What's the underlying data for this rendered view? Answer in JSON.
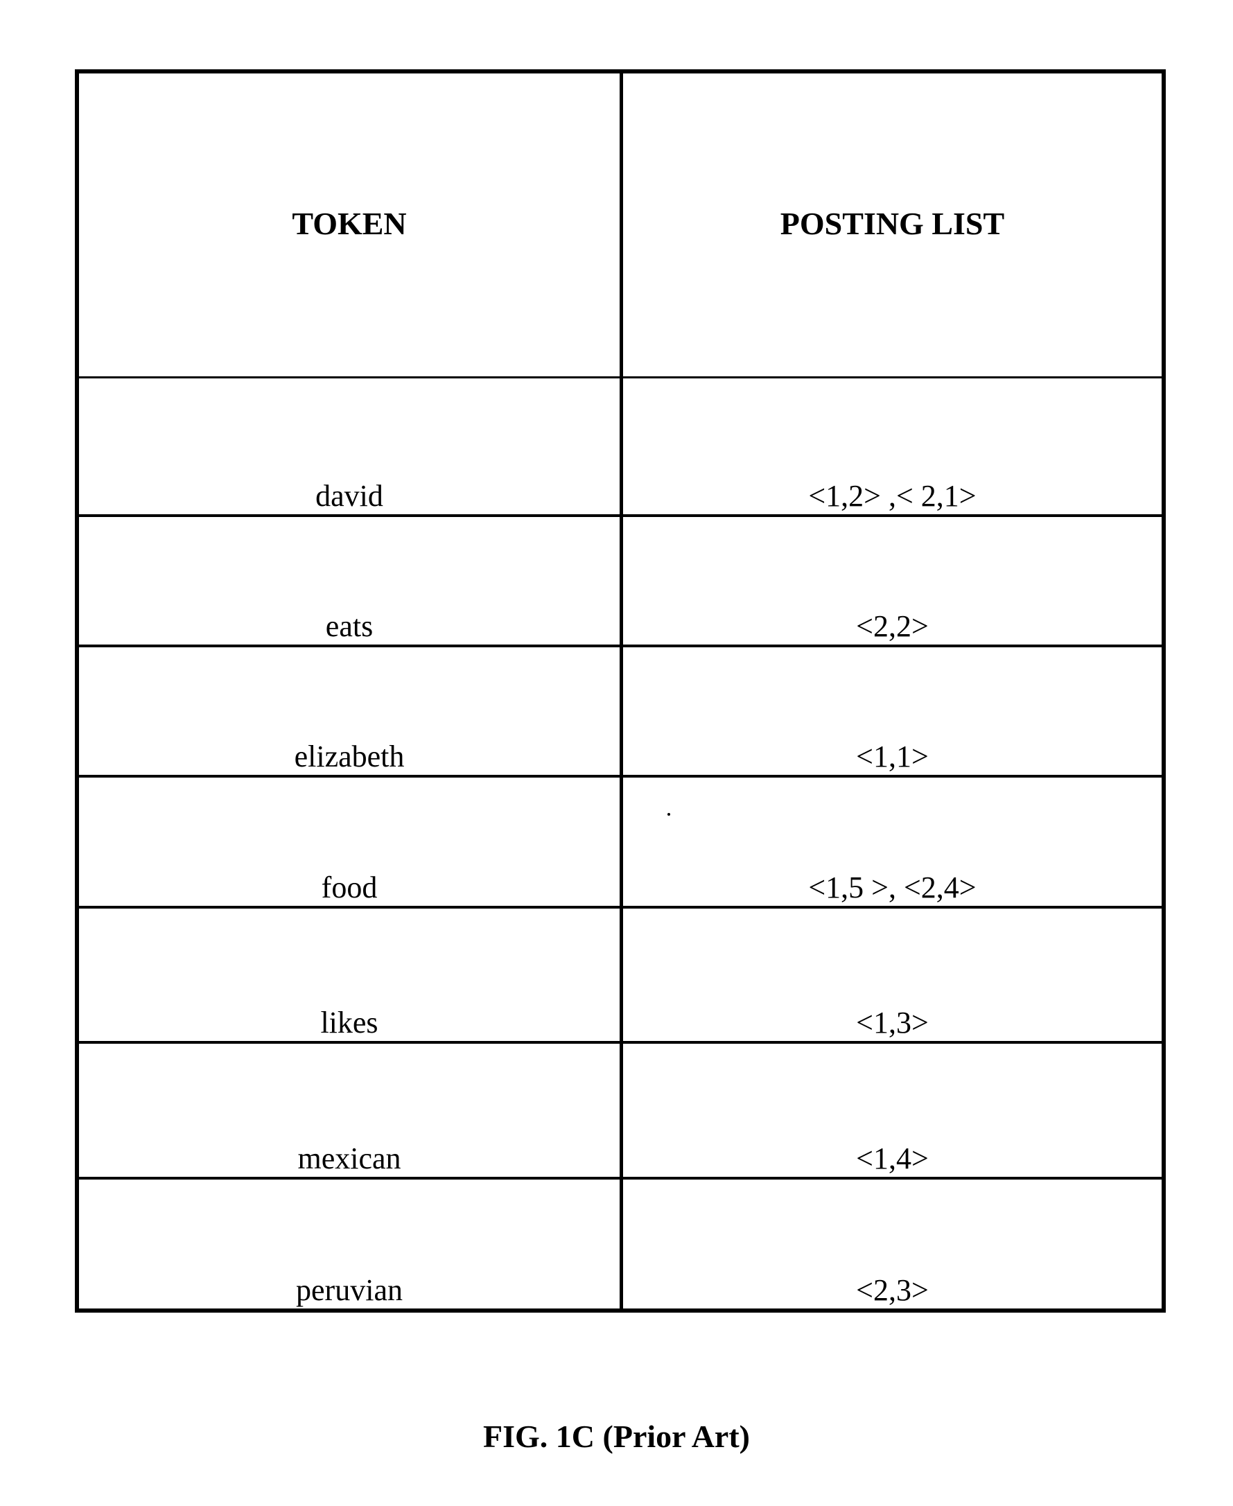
{
  "table": {
    "headers": {
      "token": "TOKEN",
      "posting_list": "POSTING LIST"
    },
    "rows": [
      {
        "token": "david",
        "posting_list": "<1,2> ,< 2,1>"
      },
      {
        "token": "eats",
        "posting_list": "<2,2>"
      },
      {
        "token": "elizabeth",
        "posting_list": "<1,1>"
      },
      {
        "token": "food",
        "posting_list": "<1,5 >, <2,4>"
      },
      {
        "token": "likes",
        "posting_list": "<1,3>"
      },
      {
        "token": "mexican",
        "posting_list": "<1,4>"
      },
      {
        "token": "peruvian",
        "posting_list": "<2,3>"
      }
    ]
  },
  "caption": "FIG. 1C (Prior Art)"
}
